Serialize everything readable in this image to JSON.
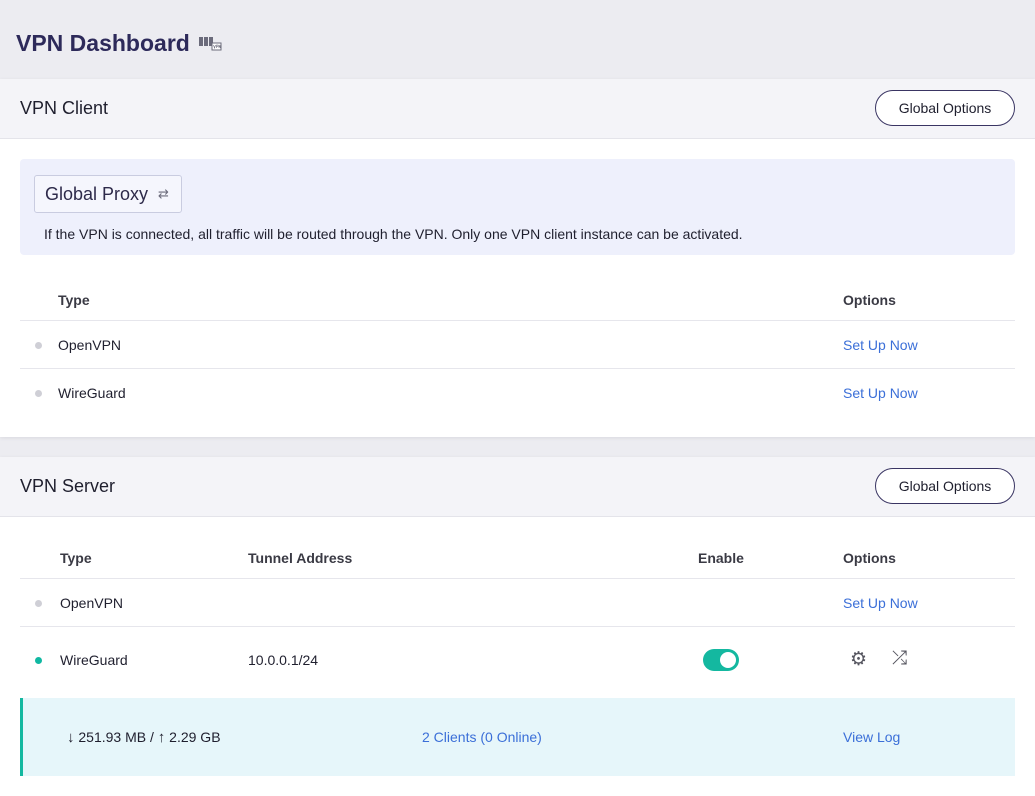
{
  "page": {
    "title": "VPN Dashboard"
  },
  "client": {
    "title": "VPN Client",
    "global_options_label": "Global Options",
    "proxy_mode": "Global Proxy",
    "proxy_description": "If the VPN is connected, all traffic will be routed through the VPN. Only one VPN client instance can be activated.",
    "columns": {
      "type": "Type",
      "options": "Options"
    },
    "rows": [
      {
        "type": "OpenVPN",
        "status": "inactive",
        "action": "Set Up Now"
      },
      {
        "type": "WireGuard",
        "status": "inactive",
        "action": "Set Up Now"
      }
    ]
  },
  "server": {
    "title": "VPN Server",
    "global_options_label": "Global Options",
    "columns": {
      "type": "Type",
      "tunnel": "Tunnel Address",
      "enable": "Enable",
      "options": "Options"
    },
    "rows": [
      {
        "type": "OpenVPN",
        "status": "inactive",
        "tunnel": "",
        "action": "Set Up Now"
      },
      {
        "type": "WireGuard",
        "status": "active",
        "tunnel": "10.0.0.1/24",
        "enabled": true
      }
    ],
    "stats": {
      "download_arrow": "↓",
      "download": "251.93 MB",
      "separator": "/",
      "upload_arrow": "↑",
      "upload": "2.29 GB",
      "clients": "2 Clients (0 Online)",
      "view_log": "View Log"
    }
  },
  "icons": {
    "vpn": "vpn-icon",
    "swap": "swap-icon",
    "settings": "gear-icon",
    "shuffle": "shuffle-icon"
  },
  "colors": {
    "title": "#2d2a5a",
    "link": "#3b6fd8",
    "active": "#10b8a2",
    "inactive": "#cfcfd6",
    "proxy_bg": "#eef0fc",
    "stats_bg": "#e6f6fa"
  }
}
